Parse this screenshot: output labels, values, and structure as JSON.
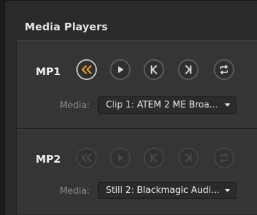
{
  "panel": {
    "title": "Media Players"
  },
  "players": [
    {
      "label": "MP1",
      "media_label": "Media:",
      "media_value": "Clip 1: ATEM 2 ME Broa...",
      "enabled": true,
      "buttons": [
        "rewind-icon",
        "play-icon",
        "previous-frame-icon",
        "next-frame-icon",
        "loop-icon"
      ]
    },
    {
      "label": "MP2",
      "media_label": "Media:",
      "media_value": "Still 2: Blackmagic Audi...",
      "enabled": false,
      "buttons": [
        "rewind-icon",
        "play-icon",
        "previous-frame-icon",
        "next-frame-icon",
        "loop-icon"
      ]
    }
  ],
  "colors": {
    "accent": "#f0a01e",
    "enabled_icon": "#d8d8d8",
    "disabled_icon": "#4a4a4a",
    "panel_bg": "#2a2a2a",
    "section_bg": "#353535"
  }
}
